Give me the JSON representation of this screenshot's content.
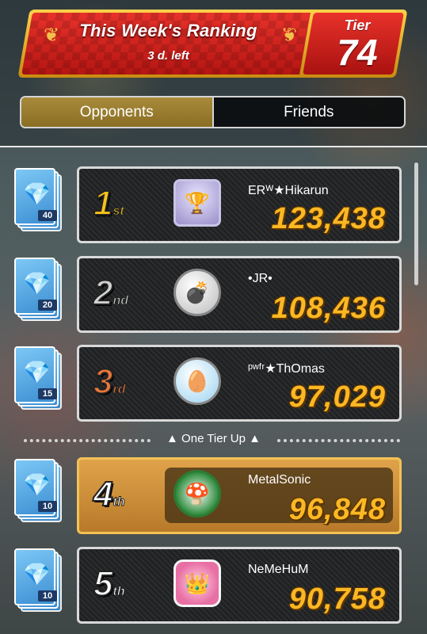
{
  "header": {
    "title": "This Week's Ranking",
    "subtitle": "3 d. left",
    "tier_label": "Tier",
    "tier_number": "74"
  },
  "tabs": [
    {
      "label": "Opponents",
      "active": true
    },
    {
      "label": "Friends",
      "active": false
    }
  ],
  "tier_up_label": "▲ One Tier Up ▲",
  "rows": [
    {
      "rank": "1",
      "suffix": "st",
      "name": "ERᵂ★Hikarun",
      "score": "123,438",
      "reward_count": "40",
      "badge": "trophy-top10-icon"
    },
    {
      "rank": "2",
      "suffix": "nd",
      "name": "•JR•",
      "score": "108,436",
      "reward_count": "20",
      "badge": "bullet-bill-icon"
    },
    {
      "rank": "3",
      "suffix": "rd",
      "name": "ᵖʷᶠʳ★ThOmas",
      "score": "97,029",
      "reward_count": "15",
      "badge": "yoshi-egg-icon"
    },
    {
      "rank": "4",
      "suffix": "th",
      "name": "MetalSonic",
      "score": "96,848",
      "reward_count": "10",
      "badge": "mario-emblem-icon",
      "highlighted": true
    },
    {
      "rank": "5",
      "suffix": "th",
      "name": "NeMeHuM",
      "score": "90,758",
      "reward_count": "10",
      "badge": "peach-emblem-icon"
    }
  ],
  "colors": {
    "banner_red": "#d8231f",
    "banner_gold": "#f2b626",
    "score_orange": "#fcb824",
    "highlight_gold": "#d99a44"
  }
}
